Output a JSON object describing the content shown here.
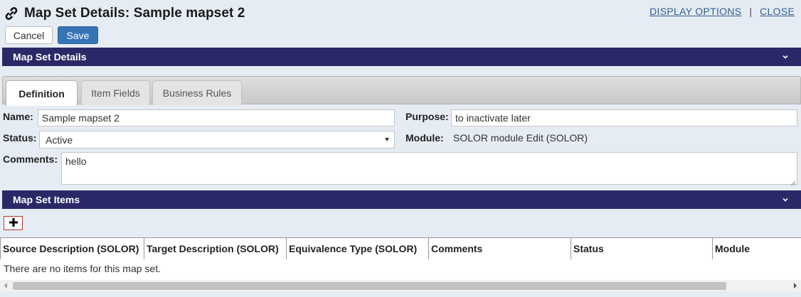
{
  "header": {
    "title": "Map Set Details: Sample mapset 2",
    "link_icon": "link-icon",
    "display_options_label": "DISPLAY OPTIONS",
    "separator": "|",
    "close_label": "CLOSE"
  },
  "actions": {
    "cancel_label": "Cancel",
    "save_label": "Save"
  },
  "details_section": {
    "title": "Map Set Details",
    "collapse_icon": "chevron-down-icon"
  },
  "tabs": [
    {
      "label": "Definition",
      "active": true
    },
    {
      "label": "Item Fields",
      "active": false
    },
    {
      "label": "Business Rules",
      "active": false
    }
  ],
  "form": {
    "name_label": "Name:",
    "name_value": "Sample mapset 2",
    "purpose_label": "Purpose:",
    "purpose_value": "to inactivate later",
    "status_label": "Status:",
    "status_value": "Active",
    "module_label": "Module:",
    "module_value": "SOLOR module Edit (SOLOR)",
    "comments_label": "Comments:",
    "comments_value": "hello"
  },
  "items_section": {
    "title": "Map Set Items",
    "collapse_icon": "chevron-down-icon",
    "add_icon": "plus-icon",
    "columns": [
      "Source Description (SOLOR)",
      "Target Description (SOLOR)",
      "Equivalence Type (SOLOR)",
      "Comments",
      "Status",
      "Module"
    ],
    "empty_message": "There are no items for this map set."
  },
  "colors": {
    "section_bar": "#2b2867",
    "save_button": "#3774b6",
    "link": "#2f5f92",
    "page_background": "#e6ecf3"
  }
}
